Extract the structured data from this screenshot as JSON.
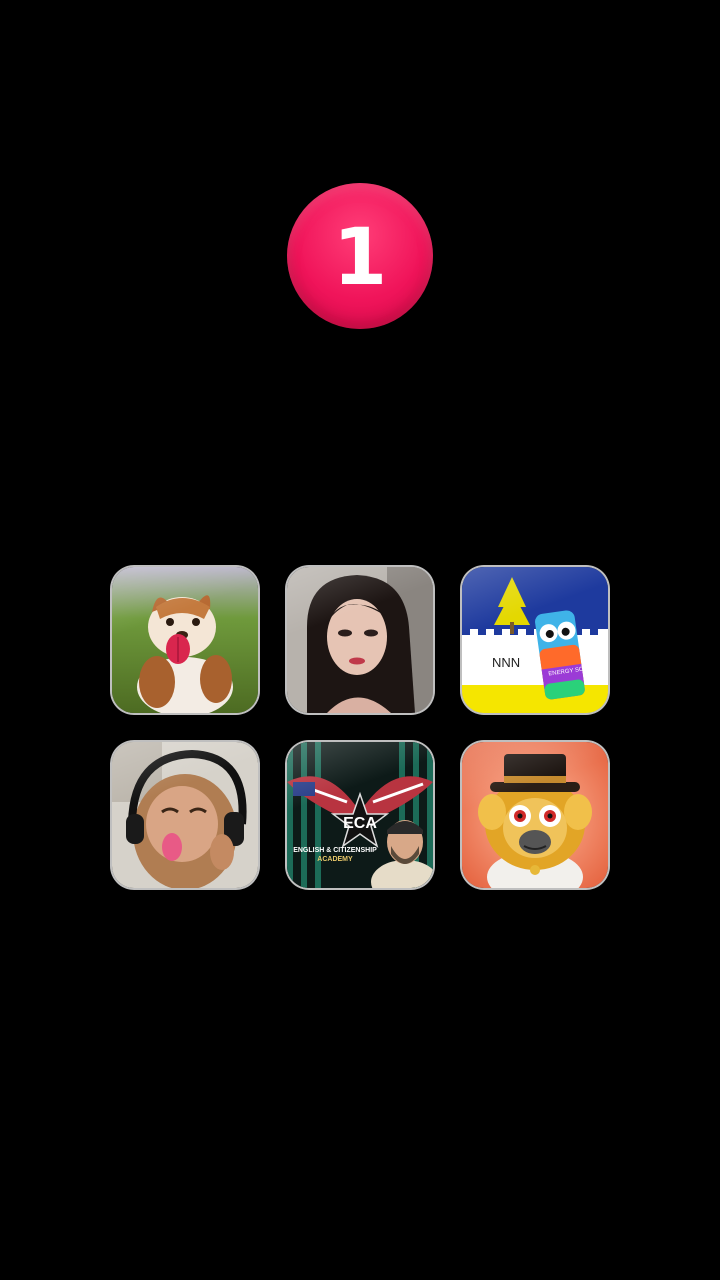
{
  "step_badge": {
    "number": "1",
    "color": "#f0145a"
  },
  "avatars": [
    {
      "name": "cat-avatar",
      "icon": "cat-with-tongue-image"
    },
    {
      "name": "woman-avatar",
      "icon": "woman-portrait-image"
    },
    {
      "name": "energy-soda-avatar",
      "icon": "energy-soda-can-image",
      "text": "NNN",
      "can_text": "ENERGY SODA"
    },
    {
      "name": "monkey-headphones-avatar",
      "icon": "monkey-with-headphones-image"
    },
    {
      "name": "eca-avatar",
      "icon": "eca-academy-logo-image",
      "logo_text": "ECA",
      "line1": "ENGLISH & CITIZENSHIP",
      "line2": "ACADEMY"
    },
    {
      "name": "golden-monkey-avatar",
      "icon": "golden-monkey-top-hat-image"
    }
  ]
}
